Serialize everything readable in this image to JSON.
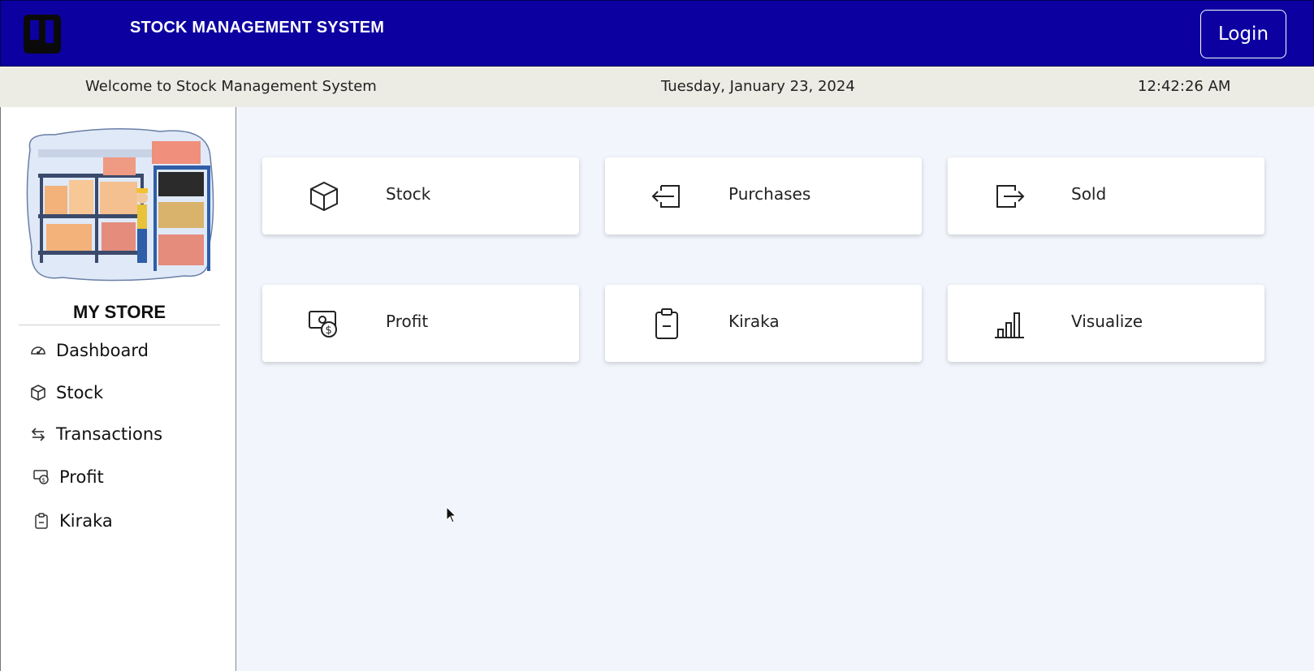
{
  "header": {
    "app_title": "STOCK MANAGEMENT SYSTEM",
    "login_label": "Login",
    "brand_color": "#0d00a0"
  },
  "infobar": {
    "welcome": "Welcome to Stock Management System",
    "date": "Tuesday, January 23, 2024",
    "time": "12:42:26 AM"
  },
  "sidebar": {
    "store_name": "MY STORE",
    "items": [
      {
        "label": "Dashboard",
        "icon": "dashboard-gauge-icon"
      },
      {
        "label": "Stock",
        "icon": "box-icon"
      },
      {
        "label": "Transactions",
        "icon": "arrows-exchange-icon"
      },
      {
        "label": "Profit",
        "icon": "cash-icon"
      },
      {
        "label": "Kiraka",
        "icon": "clipboard-icon"
      }
    ]
  },
  "main": {
    "cards": [
      {
        "label": "Stock",
        "icon": "box-icon"
      },
      {
        "label": "Purchases",
        "icon": "enter-icon"
      },
      {
        "label": "Sold",
        "icon": "exit-icon"
      },
      {
        "label": "Profit",
        "icon": "cash-icon"
      },
      {
        "label": "Kiraka",
        "icon": "clipboard-icon"
      },
      {
        "label": "Visualize",
        "icon": "bar-chart-icon"
      }
    ]
  }
}
